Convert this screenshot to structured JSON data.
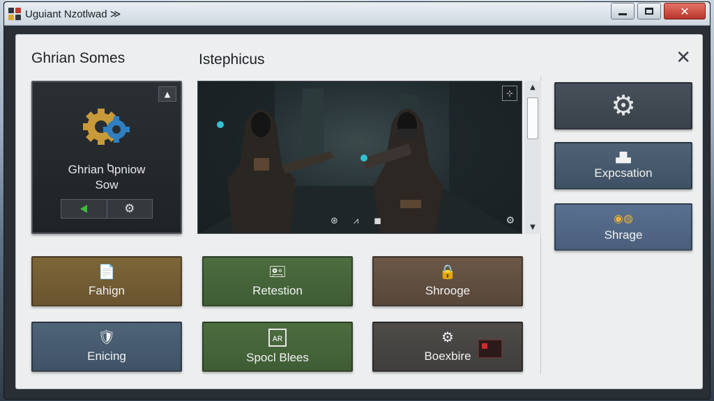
{
  "window": {
    "title": "Uguiant Nzotlwad ≫",
    "minimize_icon": "minimize-icon",
    "maximize_icon": "maximize-icon",
    "close_label": "✕"
  },
  "panel": {
    "left_title": "Ghrian Somes",
    "center_title": "Istephicus",
    "close_label": "✕"
  },
  "profile": {
    "name_line1": "Ghrian Ⴉpniow",
    "name_line2": "Sow",
    "up_label": "▲",
    "play_icon": "play-icon",
    "settings_icon": "gear-icon"
  },
  "viewer": {
    "corner_label": "⊹",
    "tools": [
      "⊛",
      "⩘",
      "◼"
    ],
    "gear_label": "⚙",
    "scroll_up": "▲",
    "scroll_down": "▼"
  },
  "tiles": [
    {
      "label": "Fahign",
      "icon": "📄"
    },
    {
      "label": "Retestion",
      "icon": "🖭"
    },
    {
      "label": "Shrooge",
      "icon": "🔒"
    },
    {
      "label": "Enicing",
      "icon": "🛡"
    },
    {
      "label": "Spocl Blees",
      "icon": "ᴀʀ"
    },
    {
      "label": "Boexbire",
      "icon": "⚙"
    }
  ],
  "side_tiles": [
    {
      "label": "",
      "icon": "⚙"
    },
    {
      "label": "Expcsation",
      "icon": "▟▙"
    },
    {
      "label": "Shrage",
      "icon": "◉◍"
    }
  ],
  "colors": {
    "titlebar": "#dce3ea",
    "panel_bg": "#eceeef",
    "close_red": "#c94535",
    "play_green": "#3dbb3d"
  }
}
